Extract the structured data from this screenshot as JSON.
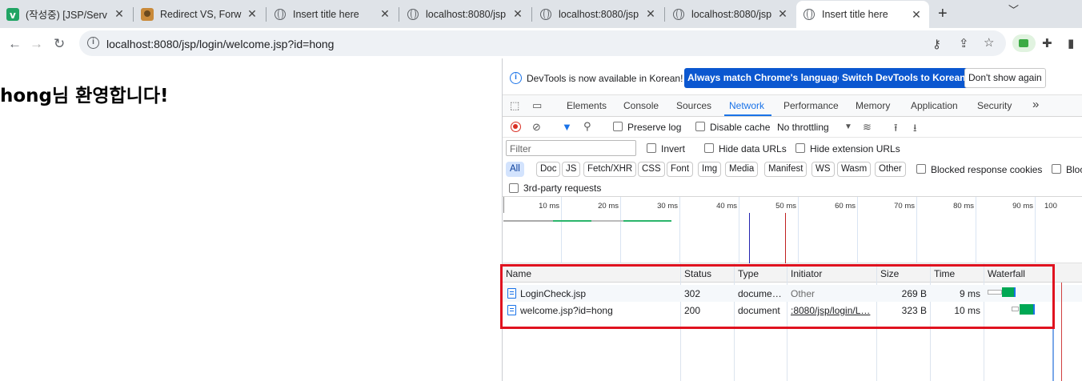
{
  "browser": {
    "tabs": [
      {
        "title": "(작성중) [JSP/Serv",
        "favicon": "v-icon"
      },
      {
        "title": "Redirect VS, Forw",
        "favicon": "avatar-icon"
      },
      {
        "title": "Insert title here",
        "favicon": "globe-icon"
      },
      {
        "title": "localhost:8080/jsp",
        "favicon": "globe-icon"
      },
      {
        "title": "localhost:8080/jsp",
        "favicon": "globe-icon"
      },
      {
        "title": "localhost:8080/jsp",
        "favicon": "globe-icon"
      },
      {
        "title": "Insert title here",
        "favicon": "globe-icon",
        "active": true
      }
    ],
    "new_tab": "+",
    "url": "localhost:8080/jsp/login/welcome.jsp?id=hong"
  },
  "page": {
    "heading": "hong님 환영합니다!"
  },
  "devtools": {
    "infobar": {
      "message": "DevTools is now available in Korean!",
      "btn_match": "Always match Chrome's language",
      "btn_switch": "Switch DevTools to Korean",
      "btn_dismiss": "Don't show again"
    },
    "panels": [
      "Elements",
      "Console",
      "Sources",
      "Network",
      "Performance",
      "Memory",
      "Application",
      "Security"
    ],
    "more": "»",
    "selected_panel": "Network",
    "controls": {
      "preserve_log": "Preserve log",
      "disable_cache": "Disable cache",
      "throttling": "No throttling"
    },
    "filter": {
      "placeholder": "Filter",
      "invert": "Invert",
      "hide_data_urls": "Hide data URLs",
      "hide_extension_urls": "Hide extension URLs"
    },
    "types": [
      "All",
      "Doc",
      "JS",
      "Fetch/XHR",
      "CSS",
      "Font",
      "Img",
      "Media",
      "Manifest",
      "WS",
      "Wasm",
      "Other"
    ],
    "blocked_response_cookies": "Blocked response cookies",
    "blocked_requests": "Bloc",
    "third_party": "3rd-party requests",
    "overview_ticks": [
      "10 ms",
      "20 ms",
      "30 ms",
      "40 ms",
      "50 ms",
      "60 ms",
      "70 ms",
      "80 ms",
      "90 ms",
      "100"
    ],
    "columns": [
      "Name",
      "Status",
      "Type",
      "Initiator",
      "Size",
      "Time",
      "Waterfall"
    ],
    "requests": [
      {
        "name": "LoginCheck.jsp",
        "status": "302",
        "type": "docume…",
        "initiator": "Other",
        "size": "269 B",
        "time": "9 ms"
      },
      {
        "name": "welcome.jsp?id=hong",
        "status": "200",
        "type": "document",
        "initiator": ":8080/jsp/login/L…",
        "size": "323 B",
        "time": "10 ms"
      }
    ],
    "colors": {
      "accent": "#1a73e8",
      "highlight": "#e0121f",
      "waterfall_green": "#00a854",
      "waterfall_blue": "#1a73e8"
    }
  }
}
